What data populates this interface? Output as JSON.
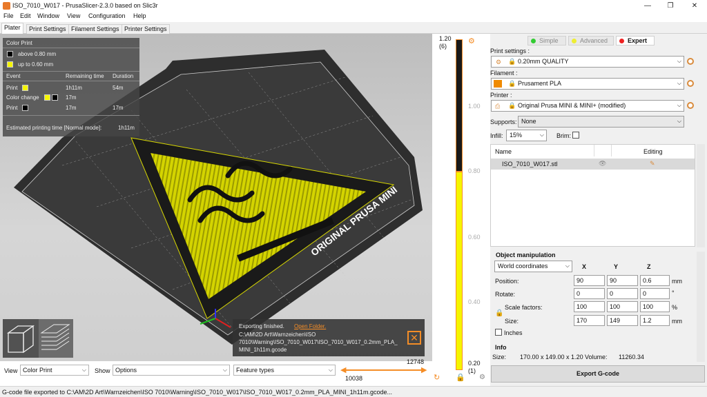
{
  "window": {
    "title": "ISO_7010_W017 - PrusaSlicer-2.3.0 based on Slic3r",
    "minimize": "—",
    "maximize": "❐",
    "close": "✕"
  },
  "menu": [
    "File",
    "Edit",
    "Window",
    "View",
    "Configuration",
    "Help"
  ],
  "tabs": [
    "Plater",
    "Print Settings",
    "Filament Settings",
    "Printer Settings"
  ],
  "legend": {
    "title": "Color Print",
    "items": [
      {
        "label": "above 0.80 mm",
        "color": "#000000"
      },
      {
        "label": "up to 0.60 mm",
        "color": "#f5f500"
      }
    ],
    "headers": {
      "event": "Event",
      "remaining": "Remaining time",
      "duration": "Duration"
    },
    "rows": [
      {
        "event": "Print",
        "remaining": "1h11m",
        "duration": "54m"
      },
      {
        "event": "Color change",
        "remaining": "17m",
        "duration": ""
      },
      {
        "event": "Print",
        "remaining": "17m",
        "duration": "17m"
      }
    ],
    "estimated_label": "Estimated printing time [Normal mode]:",
    "estimated_value": "1h11m"
  },
  "bed_label": "ORIGINAL PRUSA MINI",
  "notification": {
    "text": "Exporting finished.",
    "link": "Open Folder.",
    "path_line1": "C:\\AM\\2D Art\\Warnzeichen\\ISO",
    "path_line2": "7010\\Warning\\ISO_7010_W017\\ISO_7010_W017_0.2mm_PLA_",
    "path_line3": "MINI_1h11m.gcode"
  },
  "bottom": {
    "view_label": "View",
    "view_value": "Color Print",
    "show_label": "Show",
    "show_value": "Options",
    "feature_value": "Feature types",
    "h_slider_top": "12748",
    "h_slider_bottom": "10038"
  },
  "vslider": {
    "top_value": "1.20",
    "top_layer": "(6)",
    "bottom_value": "0.20",
    "bottom_layer": "(1)",
    "ticks": [
      "1.00",
      "0.80",
      "0.60",
      "0.40"
    ],
    "color_change_height": 0.8
  },
  "modes": {
    "simple": "Simple",
    "advanced": "Advanced",
    "expert": "Expert"
  },
  "settings": {
    "print_label": "Print settings :",
    "print_value": "0.20mm QUALITY",
    "filament_label": "Filament :",
    "filament_value": "Prusament PLA",
    "printer_label": "Printer :",
    "printer_value": "Original Prusa MINI & MINI+ (modified)",
    "supports_label": "Supports:",
    "supports_value": "None",
    "infill_label": "Infill:",
    "infill_value": "15%",
    "brim_label": "Brim:"
  },
  "objects": {
    "col_name": "Name",
    "col_editing": "Editing",
    "items": [
      {
        "name": "ISO_7010_W017.stl"
      }
    ]
  },
  "manip": {
    "title": "Object manipulation",
    "coord_value": "World coordinates",
    "axes": [
      "X",
      "Y",
      "Z"
    ],
    "position_label": "Position:",
    "position": [
      "90",
      "90",
      "0.6"
    ],
    "position_unit": "mm",
    "rotation_label": "Rotate:",
    "rotation": [
      "0",
      "0",
      "0"
    ],
    "rotation_unit": "°",
    "scale_label": "Scale factors:",
    "scale": [
      "100",
      "100",
      "100"
    ],
    "scale_unit": "%",
    "size_label": "Size:",
    "size": [
      "170",
      "149",
      "1.2"
    ],
    "size_unit": "mm",
    "inches_label": "Inches"
  },
  "info": {
    "title": "Info",
    "size_label": "Size:",
    "size_value": "170.00 x 149.00 x 1.20",
    "volume_label": "Volume:",
    "volume_value": "11260.34"
  },
  "export_button": "Export G-code",
  "status": "G-code file exported to C:\\AM\\2D Art\\Warnzeichen\\ISO 7010\\Warning\\ISO_7010_W017\\ISO_7010_W017_0.2mm_PLA_MINI_1h11m.gcode..."
}
